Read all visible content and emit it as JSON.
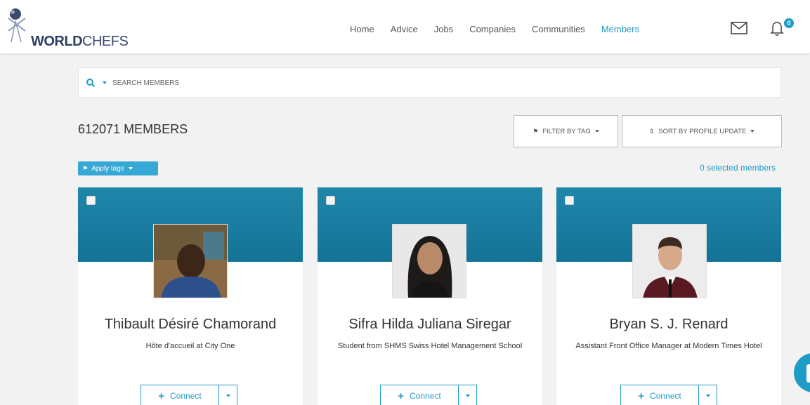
{
  "brand": {
    "bold": "WORLD",
    "light": "CHEFS",
    "accent": "#1e9bc6"
  },
  "nav": {
    "items": [
      {
        "label": "Home",
        "active": false
      },
      {
        "label": "Advice",
        "active": false
      },
      {
        "label": "Jobs",
        "active": false
      },
      {
        "label": "Companies",
        "active": false
      },
      {
        "label": "Communities",
        "active": false
      },
      {
        "label": "Members",
        "active": true
      }
    ],
    "notifications_badge": "0",
    "mail_icon": "envelope-icon",
    "bell_icon": "bell-icon"
  },
  "search": {
    "placeholder": "SEARCH MEMBERS",
    "value": ""
  },
  "members": {
    "count_label": "612071 MEMBERS",
    "filter_label": "FILTER BY TAG",
    "sort_label": "SORT BY PROFILE UPDATE",
    "apply_tags_label": "Apply tags",
    "selected_label": "0 selected members"
  },
  "cards": [
    {
      "name": "Thibault Désiré Chamorand",
      "role": "Hôte d'accueil at City One",
      "connect_label": "Connect"
    },
    {
      "name": "Sifra Hilda Juliana Siregar",
      "role": "Student from SHMS Swiss Hotel Management School",
      "connect_label": "Connect"
    },
    {
      "name": "Bryan S. J. Renard",
      "role": "Assistant Front Office Manager at Modern Times Hotel",
      "connect_label": "Connect"
    }
  ]
}
